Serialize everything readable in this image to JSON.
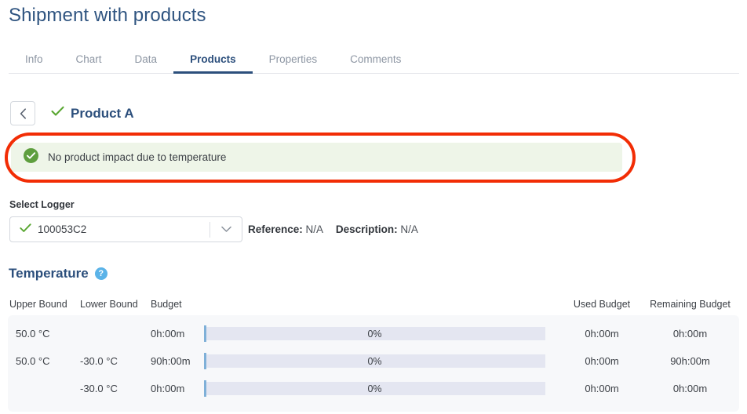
{
  "page": {
    "title": "Shipment with products"
  },
  "tabs": [
    {
      "label": "Info",
      "active": false
    },
    {
      "label": "Chart",
      "active": false
    },
    {
      "label": "Data",
      "active": false
    },
    {
      "label": "Products",
      "active": true
    },
    {
      "label": "Properties",
      "active": false
    },
    {
      "label": "Comments",
      "active": false
    }
  ],
  "product": {
    "back_label": "‹",
    "name": "Product A",
    "status_icon": "check-icon"
  },
  "alert": {
    "icon": "check-circle-icon",
    "message": "No product impact due to temperature",
    "background": "#eef5e8",
    "icon_color": "#5e9e3e"
  },
  "annotation": {
    "color": "#f22d05",
    "shape": "rounded-rectangle"
  },
  "logger": {
    "label": "Select Logger",
    "selected": "100053C2",
    "status_icon": "check-icon",
    "caret_icon": "chevron-down-icon",
    "reference_label": "Reference:",
    "reference_value": "N/A",
    "description_label": "Description:",
    "description_value": "N/A"
  },
  "temperature": {
    "title": "Temperature",
    "help_icon": "question-mark-icon",
    "help_glyph": "?",
    "columns": {
      "upper": "Upper Bound",
      "lower": "Lower Bound",
      "budget": "Budget",
      "used": "Used Budget",
      "remaining": "Remaining Budget"
    },
    "rows": [
      {
        "upper": "50.0 °C",
        "lower": "",
        "budget": "0h:00m",
        "percent": "0%",
        "percent_value": 0,
        "used": "0h:00m",
        "remaining": "0h:00m"
      },
      {
        "upper": "50.0 °C",
        "lower": "-30.0 °C",
        "budget": "90h:00m",
        "percent": "0%",
        "percent_value": 0,
        "used": "0h:00m",
        "remaining": "90h:00m"
      },
      {
        "upper": "",
        "lower": "-30.0 °C",
        "budget": "0h:00m",
        "percent": "0%",
        "percent_value": 0,
        "used": "0h:00m",
        "remaining": "0h:00m"
      }
    ]
  },
  "colors": {
    "brand_navy": "#2c4f7c",
    "tab_inactive": "#8d96a3",
    "bar_track": "#e4e6f1",
    "bar_tick": "#7fb0d8",
    "table_bg": "#f7f8fa"
  }
}
